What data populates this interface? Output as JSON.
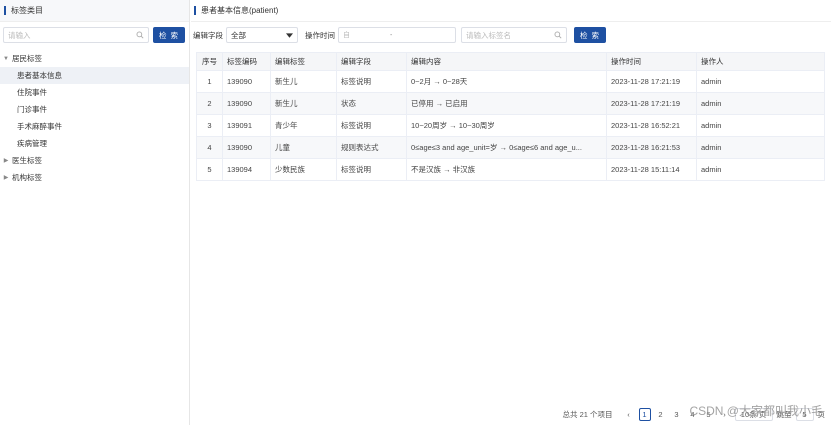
{
  "left": {
    "title": "标签类目",
    "search_placeholder": "请输入",
    "search_button": "检 索",
    "tree": [
      {
        "label": "居民标签",
        "expanded": true,
        "children": [
          "患者基本信息",
          "住院事件",
          "门诊事件",
          "手术麻醉事件",
          "疾病管理"
        ]
      },
      {
        "label": "医生标签",
        "expanded": false,
        "children": []
      },
      {
        "label": "机构标签",
        "expanded": false,
        "children": []
      }
    ],
    "active_child": "患者基本信息"
  },
  "right": {
    "title": "患者基本信息(patient)",
    "filter": {
      "field_label": "编辑字段",
      "field_value": "全部",
      "time_label": "操作时间",
      "time_placeholder_start": "自",
      "time_sep": "-",
      "keyword_placeholder": "请输入标签名",
      "search_button": "检 索"
    },
    "table": {
      "headers": [
        "序号",
        "标签编码",
        "编辑标签",
        "编辑字段",
        "编辑内容",
        "操作时间",
        "操作人"
      ],
      "rows": [
        [
          "1",
          "139090",
          "新生儿",
          "标签说明",
          "0~2月 → 0~28天",
          "2023-11-28 17:21:19",
          "admin"
        ],
        [
          "2",
          "139090",
          "新生儿",
          "状态",
          "已停用 → 已启用",
          "2023-11-28 17:21:19",
          "admin"
        ],
        [
          "3",
          "139091",
          "青少年",
          "标签说明",
          "10~20周岁 → 10~30周岁",
          "2023-11-28 16:52:21",
          "admin"
        ],
        [
          "4",
          "139090",
          "儿童",
          "规则表达式",
          "0≤age≤3 and age_unit=岁 → 0≤age≤6 and age_u...",
          "2023-11-28 16:21:53",
          "admin"
        ],
        [
          "5",
          "139094",
          "少数民族",
          "标签说明",
          "不是汉族 → 非汉族",
          "2023-11-28 15:11:14",
          "admin"
        ]
      ]
    },
    "pager": {
      "total": "总共 21 个项目",
      "prev": "‹",
      "pages": [
        "1",
        "2",
        "3",
        "4",
        "5"
      ],
      "current": "1",
      "next": "›",
      "size": "10条/页",
      "jump_label": "跳至",
      "jump_value": "5",
      "jump_unit": "页"
    },
    "watermark": "CSDN @大家都叫我小毛"
  },
  "colors": {
    "accent": "#1e50a2",
    "stripe": "#f7f8fa"
  }
}
